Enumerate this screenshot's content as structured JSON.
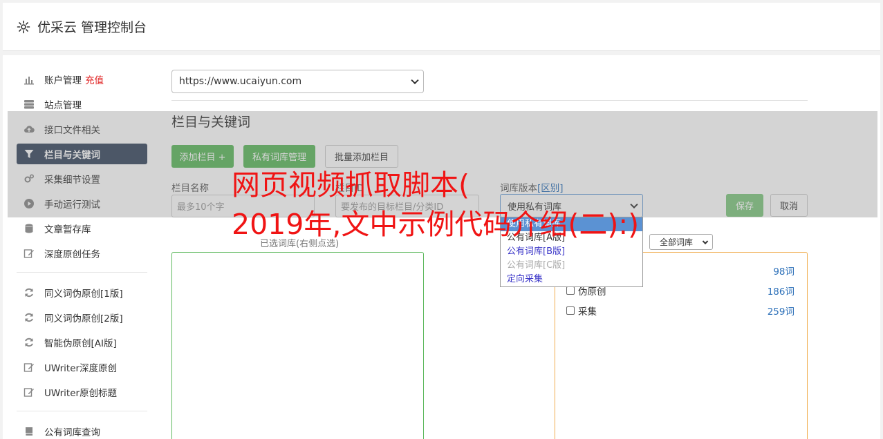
{
  "header": {
    "title": "优采云 管理控制台"
  },
  "sidebar": {
    "items": [
      {
        "label": "账户管理",
        "badge": "充值"
      },
      {
        "label": "站点管理"
      },
      {
        "label": "接口文件相关"
      },
      {
        "label": "栏目与关键词"
      },
      {
        "label": "采集细节设置"
      },
      {
        "label": "手动运行测试"
      },
      {
        "label": "文章暂存库"
      },
      {
        "label": "深度原创任务"
      }
    ],
    "items2": [
      {
        "label": "同义词伪原创[1版]"
      },
      {
        "label": "同义词伪原创[2版]"
      },
      {
        "label": "智能伪原创[AI版]"
      },
      {
        "label": "UWriter深度原创"
      },
      {
        "label": "UWriter原创标题"
      }
    ],
    "items3": [
      {
        "label": "公有词库查询"
      }
    ]
  },
  "main": {
    "site_select": "https://www.ucaiyun.com",
    "section_title": "栏目与关键词",
    "buttons": {
      "add_column": "添加栏目 +",
      "private_lib": "私有词库管理",
      "batch_add": "批量添加栏目"
    },
    "form": {
      "name_label": "栏目名称",
      "name_placeholder": "最多10个字",
      "id_label": "栏目ID",
      "id_placeholder": "要发布的目标栏目/分类ID",
      "version_label": "词库版本",
      "version_link": "[区别]",
      "version_value": "使用私有词库",
      "save": "保存",
      "cancel": "取消"
    },
    "dropdown_options": [
      "使用私有词库",
      "公有词库[A版]",
      "公有词库[B版]",
      "公有词库[C版]",
      "定向采集"
    ],
    "behind_label": "已选词库(右侧点选)",
    "all_libs": "全部词库",
    "libraries": [
      {
        "name": "",
        "count": "98词"
      },
      {
        "name": "伪原创",
        "count": "186词"
      },
      {
        "name": "采集",
        "count": "259词"
      }
    ]
  },
  "watermark": {
    "line1": "网页视频抓取脚本(",
    "line2": "2019年,文中示例代码介绍(二):)"
  }
}
